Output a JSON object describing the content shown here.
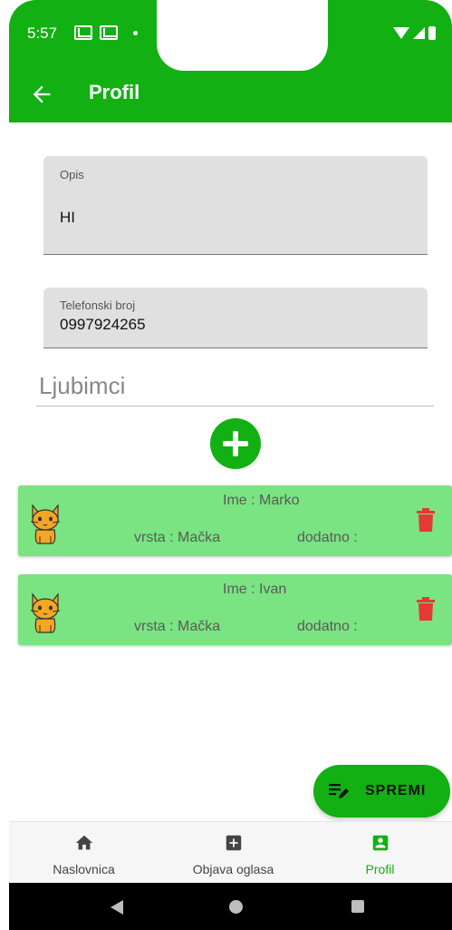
{
  "status_bar": {
    "time": "5:57",
    "icons": [
      "mail-icon",
      "mail-icon",
      "dot-icon",
      "wifi-icon",
      "signal-icon",
      "battery-icon"
    ]
  },
  "app_bar": {
    "title": "Profil",
    "back_icon": "arrow-back-icon"
  },
  "form": {
    "description": {
      "label": "Opis",
      "value": "HI"
    },
    "phone": {
      "label": "Telefonski broj",
      "value": "0997924265"
    }
  },
  "pets_section": {
    "heading": "Ljubimci",
    "add_icon": "add-circle-icon"
  },
  "pets": [
    {
      "name": "Ime : Marko",
      "species": "vrsta : Mačka",
      "extra": "dodatno :"
    },
    {
      "name": "Ime : Ivan",
      "species": "vrsta : Mačka",
      "extra": "dodatno :"
    }
  ],
  "save_fab": {
    "label": "SPREMI",
    "icon": "edit-note-icon"
  },
  "bottom_nav": {
    "items": [
      {
        "label": "Naslovnica",
        "icon": "home-icon"
      },
      {
        "label": "Objava oglasa",
        "icon": "add-box-icon"
      },
      {
        "label": "Profil",
        "icon": "account-box-icon",
        "active": true
      }
    ]
  },
  "colors": {
    "primary": "#12b012",
    "card": "#7ae482",
    "delete": "#e53935"
  }
}
